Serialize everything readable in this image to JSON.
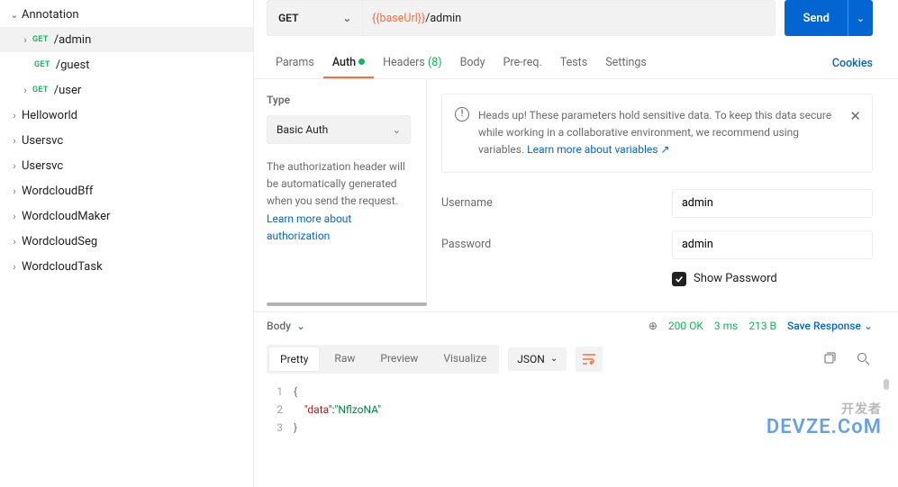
{
  "sidebar": {
    "collection": "Annotation",
    "endpoints": [
      {
        "method": "GET",
        "name": "/admin",
        "selected": true
      },
      {
        "method": "GET",
        "name": "/guest",
        "selected": false
      },
      {
        "method": "GET",
        "name": "/user",
        "selected": false
      }
    ],
    "folders": [
      "Helloworld",
      "Usersvc",
      "Usersvc",
      "WordcloudBff",
      "WordcloudMaker",
      "WordcloudSeg",
      "WordcloudTask"
    ]
  },
  "request": {
    "method": "GET",
    "url_var": "{{baseUrl}}",
    "url_path": "/admin",
    "send": "Send"
  },
  "tabs": {
    "params": "Params",
    "auth": "Auth",
    "headers": "Headers",
    "headers_count": "(8)",
    "body": "Body",
    "prereq": "Pre-req.",
    "tests": "Tests",
    "settings": "Settings",
    "cookies": "Cookies"
  },
  "auth": {
    "type_label": "Type",
    "type_value": "Basic Auth",
    "desc": "The authorization header will be automatically generated when you send the request.",
    "desc_link": "Learn more about authorization",
    "alert_text": "Heads up! These parameters hold sensitive data. To keep this data secure while working in a collaborative environment, we recommend using variables.",
    "alert_link": "Learn more about variables ↗",
    "username_label": "Username",
    "username_value": "admin",
    "password_label": "Password",
    "password_value": "admin",
    "show_password": "Show Password"
  },
  "response": {
    "body_label": "Body",
    "status": "200 OK",
    "time": "3 ms",
    "size": "213 B",
    "save": "Save Response",
    "seg_pretty": "Pretty",
    "seg_raw": "Raw",
    "seg_preview": "Preview",
    "seg_visualize": "Visualize",
    "format": "JSON",
    "json_key": "\"data\"",
    "json_val": "\"NflzoNA\""
  },
  "watermark": {
    "sub": "开发者",
    "main": "DEVZE.CoM"
  }
}
